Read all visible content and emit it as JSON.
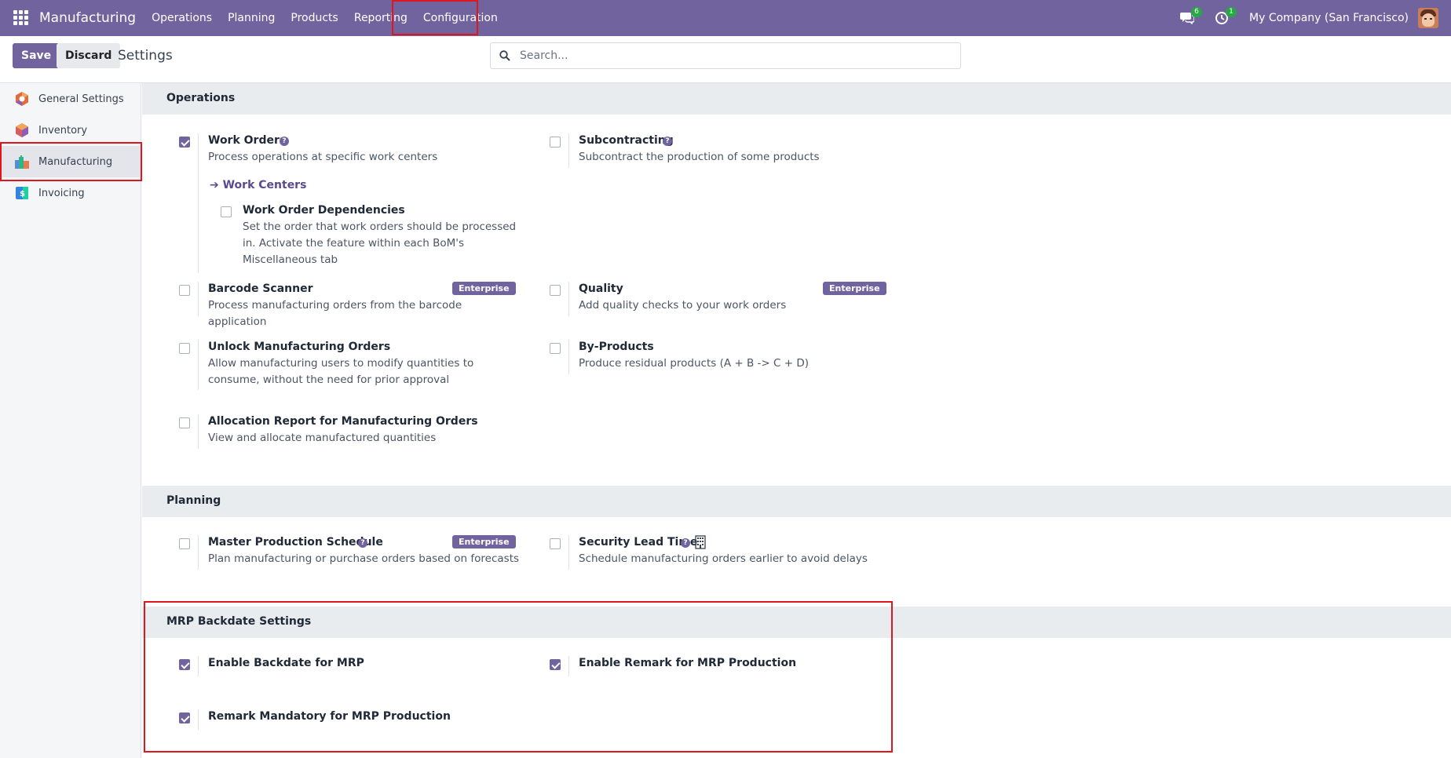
{
  "navbar": {
    "app_name": "Manufacturing",
    "menu": [
      "Operations",
      "Planning",
      "Products",
      "Reporting",
      "Configuration"
    ],
    "messages_count": "6",
    "activities_count": "1",
    "company": "My Company (San Francisco)",
    "bg_color": "#71639e"
  },
  "control": {
    "save_label": "Save",
    "discard_label": "Discard",
    "title": "Settings",
    "search_placeholder": "Search..."
  },
  "sidebar": {
    "items": [
      {
        "label": "General Settings",
        "icon": "odoo-settings-icon"
      },
      {
        "label": "Inventory",
        "icon": "inventory-icon"
      },
      {
        "label": "Manufacturing",
        "icon": "manufacturing-icon",
        "active": true
      },
      {
        "label": "Invoicing",
        "icon": "invoicing-icon"
      }
    ]
  },
  "sections": {
    "operations": {
      "title": "Operations",
      "work_orders": {
        "title": "Work Orders",
        "desc": "Process operations at specific work centers",
        "checked": true
      },
      "work_centers_link": "Work Centers",
      "work_order_deps": {
        "title": "Work Order Dependencies",
        "desc": "Set the order that work orders should be processed in. Activate the feature within each BoM's Miscellaneous tab",
        "checked": false
      },
      "subcontracting": {
        "title": "Subcontracting",
        "desc": "Subcontract the production of some products",
        "checked": false
      },
      "barcode": {
        "title": "Barcode Scanner",
        "desc": "Process manufacturing orders from the barcode application",
        "badge": "Enterprise",
        "checked": false
      },
      "quality": {
        "title": "Quality",
        "desc": "Add quality checks to your work orders",
        "badge": "Enterprise",
        "checked": false
      },
      "unlock": {
        "title": "Unlock Manufacturing Orders",
        "desc": "Allow manufacturing users to modify quantities to consume, without the need for prior approval",
        "checked": false
      },
      "byproducts": {
        "title": "By-Products",
        "desc": "Produce residual products (A + B -> C + D)",
        "checked": false
      },
      "allocation": {
        "title": "Allocation Report for Manufacturing Orders",
        "desc": "View and allocate manufactured quantities",
        "checked": false
      }
    },
    "planning": {
      "title": "Planning",
      "mps": {
        "title": "Master Production Schedule",
        "desc": "Plan manufacturing or purchase orders based on forecasts",
        "badge": "Enterprise",
        "checked": false
      },
      "lead_time": {
        "title": "Security Lead Time",
        "desc": "Schedule manufacturing orders earlier to avoid delays",
        "checked": false
      }
    },
    "mrp_backdate": {
      "title": "MRP Backdate Settings",
      "enable_backdate": {
        "title": "Enable Backdate for MRP",
        "checked": true
      },
      "enable_remark": {
        "title": "Enable Remark for MRP Production",
        "checked": true
      },
      "remark_mandatory": {
        "title": "Remark Mandatory for MRP Production",
        "checked": true
      }
    }
  }
}
